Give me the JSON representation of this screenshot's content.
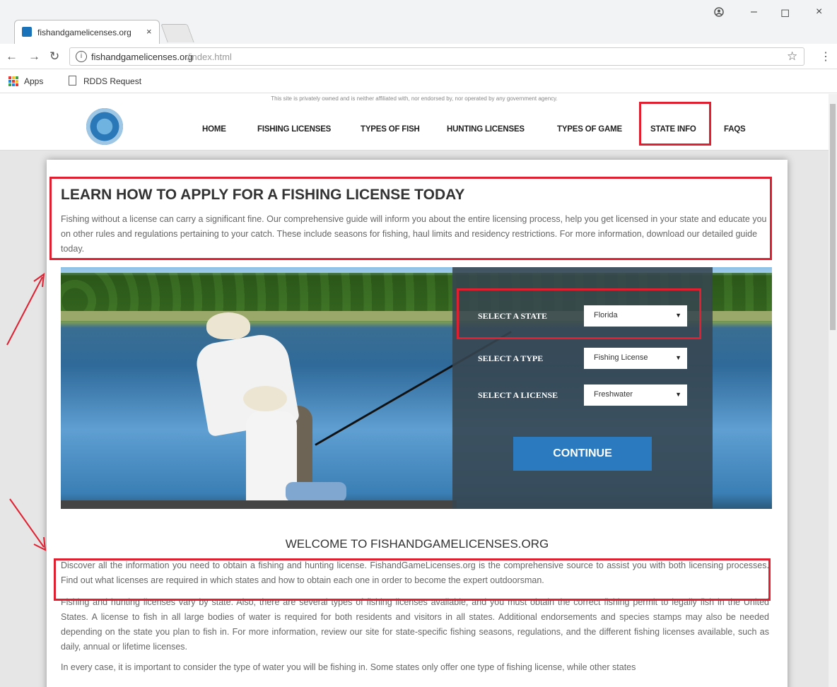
{
  "browser": {
    "tab_title": "fishandgamelicenses.org",
    "tab_close": "×",
    "url_domain": "fishandgamelicenses.org",
    "url_path": "/index.html",
    "bookmarks": [
      "Apps",
      "RDDS Request"
    ],
    "window_controls": [
      "–",
      "◻",
      "×"
    ],
    "account_icon": "account-icon"
  },
  "site": {
    "disclaimer": "This site is privately owned and is neither affiliated with, nor endorsed by, nor operated by any government agency.",
    "nav": [
      "HOME",
      "FISHING LICENSES",
      "TYPES OF FISH",
      "HUNTING LICENSES",
      "TYPES OF GAME",
      "STATE INFO",
      "FAQS"
    ],
    "title": "LEARN HOW TO APPLY FOR A FISHING LICENSE TODAY",
    "intro": "Fishing without a license can carry a significant fine. Our comprehensive guide will inform you about the entire licensing process, help you get licensed in your state and educate you on other rules and regulations pertaining to your catch. These include seasons for fishing, haul limits and residency restrictions. For more information, download our detailed guide today.",
    "form": {
      "state_label": "SELECT A STATE",
      "state_value": "Florida",
      "type_label": "SELECT A TYPE",
      "type_value": "Fishing License",
      "license_label": "SELECT A LICENSE",
      "license_value": "Freshwater",
      "continue": "CONTINUE"
    },
    "welcome_title": "WELCOME TO FISHANDGAMELICENSES.ORG",
    "welcome_p1": "Discover all the information you need to obtain a fishing and hunting license. FishandGameLicenses.org is the comprehensive source to assist you with both licensing processes. Find out what licenses are required in which states and how to obtain each one in order to become the expert outdoorsman.",
    "welcome_p2": "Fishing and hunting licenses vary by state. Also, there are several types of fishing licenses available, and you must obtain the correct fishing permit to legally fish in the United States. A license to fish in all large bodies of water is required for both residents and visitors in all states. Additional endorsements and species stamps may also be needed depending on the state you plan to fish in. For more information, review our site for state-specific fishing seasons, regulations, and the different fishing licenses available, such as daily, annual or lifetime licenses.",
    "welcome_p3": "In every case, it is important to consider the type of water you will be fishing in. Some states only offer one type of fishing license, while other states"
  },
  "colors": {
    "annotation": "#e02030",
    "button": "#2b7ac0"
  }
}
